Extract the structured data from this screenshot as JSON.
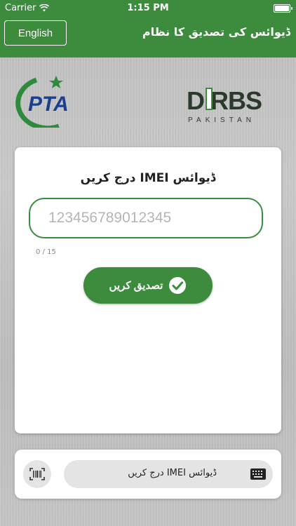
{
  "status_bar": {
    "carrier": "Carrier",
    "time": "1:15 PM"
  },
  "header": {
    "language_button": "English",
    "title": "ڈیوائس کی تصدیق کا نظام"
  },
  "logos": {
    "pta": "PTA",
    "dirbs": "DIRBS",
    "dirbs_sub": "PAKISTAN"
  },
  "card": {
    "title": "ڈیوائس IMEI درج کریں",
    "imei_placeholder": "123456789012345",
    "imei_value": "",
    "counter": "0 / 15",
    "verify_label": "تصدیق کریں"
  },
  "bottom_bar": {
    "input_label": "ڈیوائس IMEI درج کریں"
  },
  "colors": {
    "brand_green": "#3d8b3d",
    "pta_blue": "#1b3f8f",
    "dirbs_dark": "#2b3a2b"
  }
}
